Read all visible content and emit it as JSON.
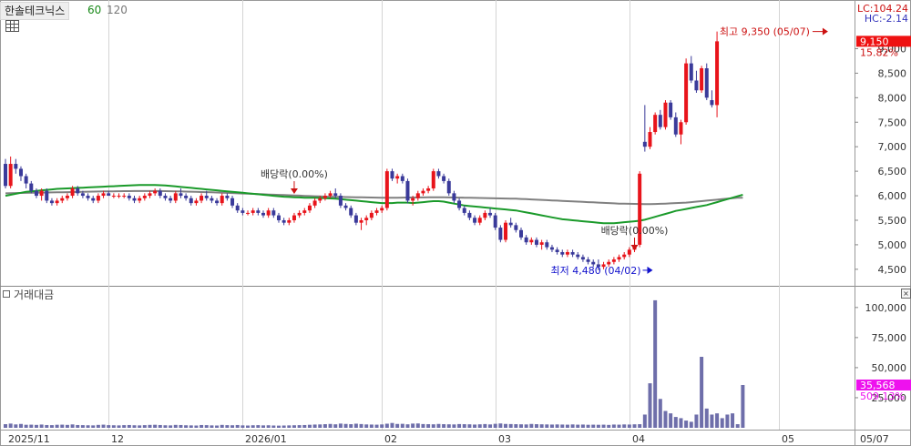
{
  "header": {
    "stock_name": "한솔테크닉스",
    "ma_labels": [
      {
        "label": "60",
        "color": "#1a8a1a"
      },
      {
        "label": "120",
        "color": "#777777"
      }
    ]
  },
  "volume_panel": {
    "title": "거래대금",
    "close_label": "×"
  },
  "right_info": {
    "lc": "LC:104.24",
    "hc": "HC:-2.14",
    "price_badge": "9,150",
    "price_change": "15.82%",
    "volume_badge": "35,568",
    "volume_change": "509.13%"
  },
  "colors": {
    "up": "#e8141b",
    "down": "#3a3a9a",
    "ma60": "#1a9a2a",
    "ma120": "#808080",
    "volume": "#6e6eaa",
    "price_badge_bg": "#ee1111",
    "volume_badge_bg": "#ee11ee"
  },
  "chart_data": {
    "type": "candlestick",
    "price_axis": {
      "min": 4200,
      "max": 9900,
      "ticks": [
        4500,
        5000,
        5500,
        6000,
        6500,
        7000,
        7500,
        8000,
        8500,
        9000
      ],
      "tick_labels": [
        "4,500",
        "5,000",
        "5,500",
        "6,000",
        "6,500",
        "7,000",
        "7,500",
        "8,000",
        "8,500",
        "9,000"
      ]
    },
    "volume_axis": {
      "min": 0,
      "max": 115000,
      "ticks": [
        25000,
        50000,
        75000,
        100000
      ],
      "tick_labels": [
        "25,000",
        "50,000",
        "75,000",
        "100,000"
      ]
    },
    "x_labels": [
      {
        "index": 0,
        "label": "2025/11"
      },
      {
        "index": 20,
        "label": "12"
      },
      {
        "index": 46,
        "label": "2026/01"
      },
      {
        "index": 73,
        "label": "02"
      },
      {
        "index": 95,
        "label": "03"
      },
      {
        "index": 121,
        "label": "04"
      },
      {
        "index": 150,
        "label": "05"
      },
      {
        "index": 159,
        "label": "05/07"
      }
    ],
    "candles": [
      [
        6650,
        6750,
        6150,
        6200
      ],
      [
        6200,
        6800,
        6150,
        6650
      ],
      [
        6650,
        6750,
        6450,
        6550
      ],
      [
        6550,
        6600,
        6300,
        6400
      ],
      [
        6400,
        6450,
        6150,
        6250
      ],
      [
        6250,
        6300,
        6050,
        6100
      ],
      [
        6100,
        6150,
        5950,
        6000
      ],
      [
        6000,
        6150,
        5900,
        6100
      ],
      [
        6100,
        6150,
        5850,
        5900
      ],
      [
        5900,
        5950,
        5800,
        5850
      ],
      [
        5850,
        5950,
        5800,
        5900
      ],
      [
        5900,
        6000,
        5850,
        5950
      ],
      [
        5950,
        6050,
        5900,
        6000
      ],
      [
        6000,
        6200,
        5950,
        6150
      ],
      [
        6150,
        6200,
        6000,
        6050
      ],
      [
        6050,
        6100,
        5950,
        6000
      ],
      [
        6000,
        6050,
        5900,
        5950
      ],
      [
        5950,
        6000,
        5850,
        5900
      ],
      [
        5900,
        6050,
        5850,
        6000
      ],
      [
        6000,
        6100,
        5950,
        6050
      ],
      [
        6050,
        6100,
        6000,
        6000
      ],
      [
        6000,
        6050,
        5950,
        6000
      ],
      [
        6000,
        6050,
        5950,
        6000
      ],
      [
        6000,
        6050,
        5950,
        6000
      ],
      [
        6000,
        6050,
        5900,
        5950
      ],
      [
        5950,
        6000,
        5850,
        5900
      ],
      [
        5900,
        6000,
        5850,
        5950
      ],
      [
        5950,
        6050,
        5900,
        6000
      ],
      [
        6000,
        6100,
        5950,
        6050
      ],
      [
        6050,
        6150,
        6000,
        6100
      ],
      [
        6100,
        6150,
        5950,
        6000
      ],
      [
        6000,
        6050,
        5900,
        5950
      ],
      [
        5950,
        6000,
        5850,
        5900
      ],
      [
        5900,
        6100,
        5850,
        6050
      ],
      [
        6050,
        6150,
        5950,
        6000
      ],
      [
        6000,
        6050,
        5900,
        5950
      ],
      [
        5950,
        6000,
        5800,
        5850
      ],
      [
        5850,
        5950,
        5800,
        5900
      ],
      [
        5900,
        6050,
        5850,
        6000
      ],
      [
        6000,
        6100,
        5900,
        5950
      ],
      [
        5950,
        6000,
        5850,
        5900
      ],
      [
        5900,
        5950,
        5800,
        5850
      ],
      [
        5850,
        6050,
        5800,
        6000
      ],
      [
        6000,
        6050,
        5900,
        5950
      ],
      [
        5950,
        6000,
        5750,
        5800
      ],
      [
        5800,
        5850,
        5650,
        5700
      ],
      [
        5700,
        5750,
        5600,
        5650
      ],
      [
        5650,
        5700,
        5600,
        5650
      ],
      [
        5650,
        5750,
        5600,
        5700
      ],
      [
        5700,
        5750,
        5600,
        5650
      ],
      [
        5650,
        5700,
        5550,
        5600
      ],
      [
        5600,
        5750,
        5550,
        5700
      ],
      [
        5700,
        5750,
        5550,
        5600
      ],
      [
        5600,
        5650,
        5450,
        5500
      ],
      [
        5500,
        5550,
        5400,
        5450
      ],
      [
        5450,
        5550,
        5400,
        5500
      ],
      [
        5500,
        5650,
        5450,
        5600
      ],
      [
        5600,
        5700,
        5550,
        5650
      ],
      [
        5650,
        5750,
        5600,
        5700
      ],
      [
        5700,
        5850,
        5650,
        5800
      ],
      [
        5800,
        5950,
        5750,
        5900
      ],
      [
        5900,
        6000,
        5850,
        5950
      ],
      [
        5950,
        6050,
        5900,
        6000
      ],
      [
        6000,
        6100,
        5950,
        6050
      ],
      [
        6050,
        6150,
        5950,
        6000
      ],
      [
        6000,
        6050,
        5750,
        5800
      ],
      [
        5800,
        5850,
        5700,
        5750
      ],
      [
        5750,
        5800,
        5550,
        5600
      ],
      [
        5600,
        5650,
        5400,
        5450
      ],
      [
        5450,
        5550,
        5300,
        5500
      ],
      [
        5500,
        5600,
        5400,
        5550
      ],
      [
        5550,
        5700,
        5500,
        5650
      ],
      [
        5650,
        5750,
        5600,
        5700
      ],
      [
        5700,
        5800,
        5650,
        5750
      ],
      [
        5750,
        6550,
        5700,
        6500
      ],
      [
        6500,
        6550,
        6300,
        6350
      ],
      [
        6350,
        6450,
        6250,
        6400
      ],
      [
        6400,
        6450,
        6250,
        6300
      ],
      [
        6300,
        6350,
        5850,
        5900
      ],
      [
        5900,
        6000,
        5800,
        5950
      ],
      [
        5950,
        6100,
        5900,
        6050
      ],
      [
        6050,
        6150,
        6000,
        6100
      ],
      [
        6100,
        6200,
        6050,
        6150
      ],
      [
        6150,
        6550,
        6100,
        6500
      ],
      [
        6500,
        6550,
        6350,
        6400
      ],
      [
        6400,
        6450,
        6250,
        6300
      ],
      [
        6300,
        6350,
        6000,
        6050
      ],
      [
        6050,
        6100,
        5850,
        5900
      ],
      [
        5900,
        5950,
        5700,
        5750
      ],
      [
        5750,
        5800,
        5600,
        5650
      ],
      [
        5650,
        5700,
        5500,
        5550
      ],
      [
        5550,
        5600,
        5400,
        5450
      ],
      [
        5450,
        5600,
        5400,
        5550
      ],
      [
        5550,
        5700,
        5500,
        5650
      ],
      [
        5650,
        5750,
        5550,
        5600
      ],
      [
        5600,
        5650,
        5300,
        5350
      ],
      [
        5350,
        5400,
        5050,
        5100
      ],
      [
        5100,
        5500,
        5050,
        5450
      ],
      [
        5450,
        5550,
        5350,
        5400
      ],
      [
        5400,
        5450,
        5250,
        5300
      ],
      [
        5300,
        5350,
        5100,
        5150
      ],
      [
        5150,
        5200,
        5000,
        5050
      ],
      [
        5050,
        5150,
        5000,
        5100
      ],
      [
        5100,
        5150,
        4950,
        5000
      ],
      [
        5000,
        5100,
        4900,
        5050
      ],
      [
        5050,
        5100,
        4900,
        4950
      ],
      [
        4950,
        5000,
        4850,
        4900
      ],
      [
        4900,
        4950,
        4800,
        4850
      ],
      [
        4850,
        4900,
        4750,
        4800
      ],
      [
        4800,
        4900,
        4750,
        4850
      ],
      [
        4850,
        4900,
        4750,
        4800
      ],
      [
        4800,
        4850,
        4700,
        4750
      ],
      [
        4750,
        4800,
        4650,
        4700
      ],
      [
        4700,
        4750,
        4600,
        4650
      ],
      [
        4650,
        4700,
        4550,
        4600
      ],
      [
        4600,
        4700,
        4480,
        4550
      ],
      [
        4550,
        4650,
        4500,
        4600
      ],
      [
        4600,
        4700,
        4550,
        4650
      ],
      [
        4650,
        4750,
        4600,
        4700
      ],
      [
        4700,
        4800,
        4650,
        4750
      ],
      [
        4750,
        4850,
        4700,
        4800
      ],
      [
        4800,
        4950,
        4750,
        4900
      ],
      [
        4900,
        5050,
        4850,
        5000
      ],
      [
        5000,
        6500,
        4950,
        6450
      ],
      [
        7100,
        7850,
        6900,
        7000
      ],
      [
        7000,
        7400,
        6950,
        7300
      ],
      [
        7300,
        7700,
        7250,
        7650
      ],
      [
        7650,
        7750,
        7350,
        7400
      ],
      [
        7400,
        7950,
        7350,
        7900
      ],
      [
        7900,
        7950,
        7550,
        7600
      ],
      [
        7600,
        7700,
        7200,
        7250
      ],
      [
        7250,
        7550,
        7050,
        7500
      ],
      [
        7500,
        8800,
        7450,
        8700
      ],
      [
        8700,
        8850,
        8300,
        8350
      ],
      [
        8350,
        8550,
        8100,
        8150
      ],
      [
        8150,
        8650,
        8100,
        8600
      ],
      [
        8600,
        8700,
        7950,
        8000
      ],
      [
        7950,
        8150,
        7800,
        7850
      ],
      [
        7850,
        9350,
        7600,
        9150
      ]
    ],
    "volumes": [
      3000,
      3500,
      2800,
      3200,
      2500,
      2600,
      2400,
      2700,
      2300,
      2200,
      2500,
      2600,
      2400,
      2800,
      2300,
      2200,
      2100,
      2000,
      2400,
      2600,
      2200,
      2100,
      2000,
      2200,
      2300,
      2100,
      2000,
      2200,
      2400,
      2500,
      2300,
      2100,
      2000,
      2400,
      2300,
      2100,
      2000,
      1900,
      2300,
      2200,
      2000,
      1900,
      2400,
      2200,
      2100,
      2300,
      2000,
      1900,
      2100,
      2200,
      2000,
      2100,
      1900,
      1800,
      1900,
      2000,
      2100,
      2200,
      2300,
      2500,
      2700,
      2800,
      3000,
      3200,
      2900,
      3500,
      3200,
      3000,
      3400,
      3100,
      2800,
      2700,
      2600,
      2800,
      3400,
      4000,
      3200,
      3300,
      2900,
      3500,
      3600,
      3100,
      3000,
      2900,
      3200,
      3000,
      2900,
      2800,
      3100,
      3000,
      2900,
      2700,
      2900,
      3100,
      2800,
      3300,
      3600,
      3200,
      3100,
      3000,
      2900,
      2800,
      3200,
      3000,
      2900,
      2800,
      2700,
      2800,
      2700,
      2600,
      2800,
      2600,
      2700,
      2500,
      2600,
      2500,
      2600,
      2400,
      2700,
      2600,
      2800,
      2700,
      2900,
      3000,
      11000,
      37000,
      106000,
      24000,
      14000,
      12000,
      9000,
      8000,
      6000,
      5000,
      11000,
      59000,
      16000,
      11000,
      12000,
      8000,
      11000,
      12000,
      3000,
      35568
    ],
    "ma60": [
      6000,
      6020,
      6040,
      6060,
      6080,
      6090,
      6100,
      6110,
      6120,
      6130,
      6140,
      6145,
      6150,
      6155,
      6160,
      6165,
      6170,
      6175,
      6180,
      6185,
      6190,
      6195,
      6200,
      6205,
      6210,
      6215,
      6220,
      6220,
      6220,
      6220,
      6215,
      6210,
      6200,
      6190,
      6180,
      6170,
      6160,
      6150,
      6140,
      6130,
      6120,
      6110,
      6100,
      6090,
      6080,
      6070,
      6060,
      6050,
      6040,
      6030,
      6020,
      6010,
      6000,
      5990,
      5980,
      5975,
      5970,
      5965,
      5960,
      5960,
      5960,
      5955,
      5950,
      5945,
      5940,
      5930,
      5920,
      5910,
      5900,
      5890,
      5880,
      5870,
      5860,
      5850,
      5850,
      5850,
      5860,
      5860,
      5860,
      5850,
      5860,
      5870,
      5880,
      5890,
      5890,
      5880,
      5860,
      5840,
      5820,
      5800,
      5790,
      5780,
      5770,
      5760,
      5750,
      5740,
      5730,
      5720,
      5710,
      5700,
      5680,
      5660,
      5640,
      5620,
      5600,
      5580,
      5560,
      5540,
      5520,
      5510,
      5500,
      5490,
      5480,
      5470,
      5460,
      5450,
      5440,
      5440,
      5440,
      5450,
      5460,
      5470,
      5480,
      5490,
      5510,
      5540,
      5570,
      5600,
      5630,
      5660,
      5690,
      5710,
      5730,
      5750,
      5770,
      5790,
      5810,
      5840,
      5870,
      5900,
      5930,
      5960,
      5990,
      6020
    ],
    "ma120": [
      6050,
      6052,
      6054,
      6056,
      6058,
      6060,
      6062,
      6064,
      6066,
      6068,
      6070,
      6072,
      6074,
      6076,
      6078,
      6080,
      6082,
      6084,
      6086,
      6088,
      6090,
      6091,
      6092,
      6093,
      6094,
      6095,
      6096,
      6096,
      6096,
      6096,
      6095,
      6094,
      6092,
      6090,
      6088,
      6085,
      6082,
      6079,
      6076,
      6073,
      6070,
      6066,
      6062,
      6058,
      6054,
      6050,
      6046,
      6042,
      6038,
      6034,
      6030,
      6026,
      6022,
      6018,
      6014,
      6010,
      6006,
      6002,
      5998,
      5994,
      5990,
      5986,
      5982,
      5980,
      5978,
      5976,
      5974,
      5972,
      5970,
      5968,
      5966,
      5964,
      5962,
      5960,
      5960,
      5960,
      5961,
      5962,
      5963,
      5964,
      5965,
      5966,
      5967,
      5968,
      5968,
      5967,
      5966,
      5964,
      5962,
      5960,
      5958,
      5956,
      5954,
      5952,
      5950,
      5948,
      5946,
      5944,
      5942,
      5940,
      5935,
      5930,
      5925,
      5920,
      5915,
      5910,
      5905,
      5900,
      5895,
      5890,
      5885,
      5880,
      5875,
      5870,
      5865,
      5860,
      5855,
      5850,
      5845,
      5840,
      5838,
      5836,
      5834,
      5832,
      5830,
      5830,
      5832,
      5835,
      5840,
      5845,
      5850,
      5855,
      5860,
      5870,
      5880,
      5890,
      5900,
      5910,
      5920,
      5930,
      5940,
      5950,
      5960,
      5960
    ],
    "annotations": [
      {
        "label": "배당락(0.00%)",
        "index": 56,
        "price": 6000,
        "color": "#cc1111"
      },
      {
        "label": "배당락(0.00%)",
        "index": 122,
        "price": 4850,
        "color": "#cc1111"
      },
      {
        "label": "최저 4,480 (04/02)",
        "index": 125,
        "price": 4480,
        "color": "#1111cc"
      },
      {
        "label": "최고 9,350 (05/07)",
        "index": 159,
        "price": 9350,
        "color": "#cc1111"
      }
    ]
  }
}
